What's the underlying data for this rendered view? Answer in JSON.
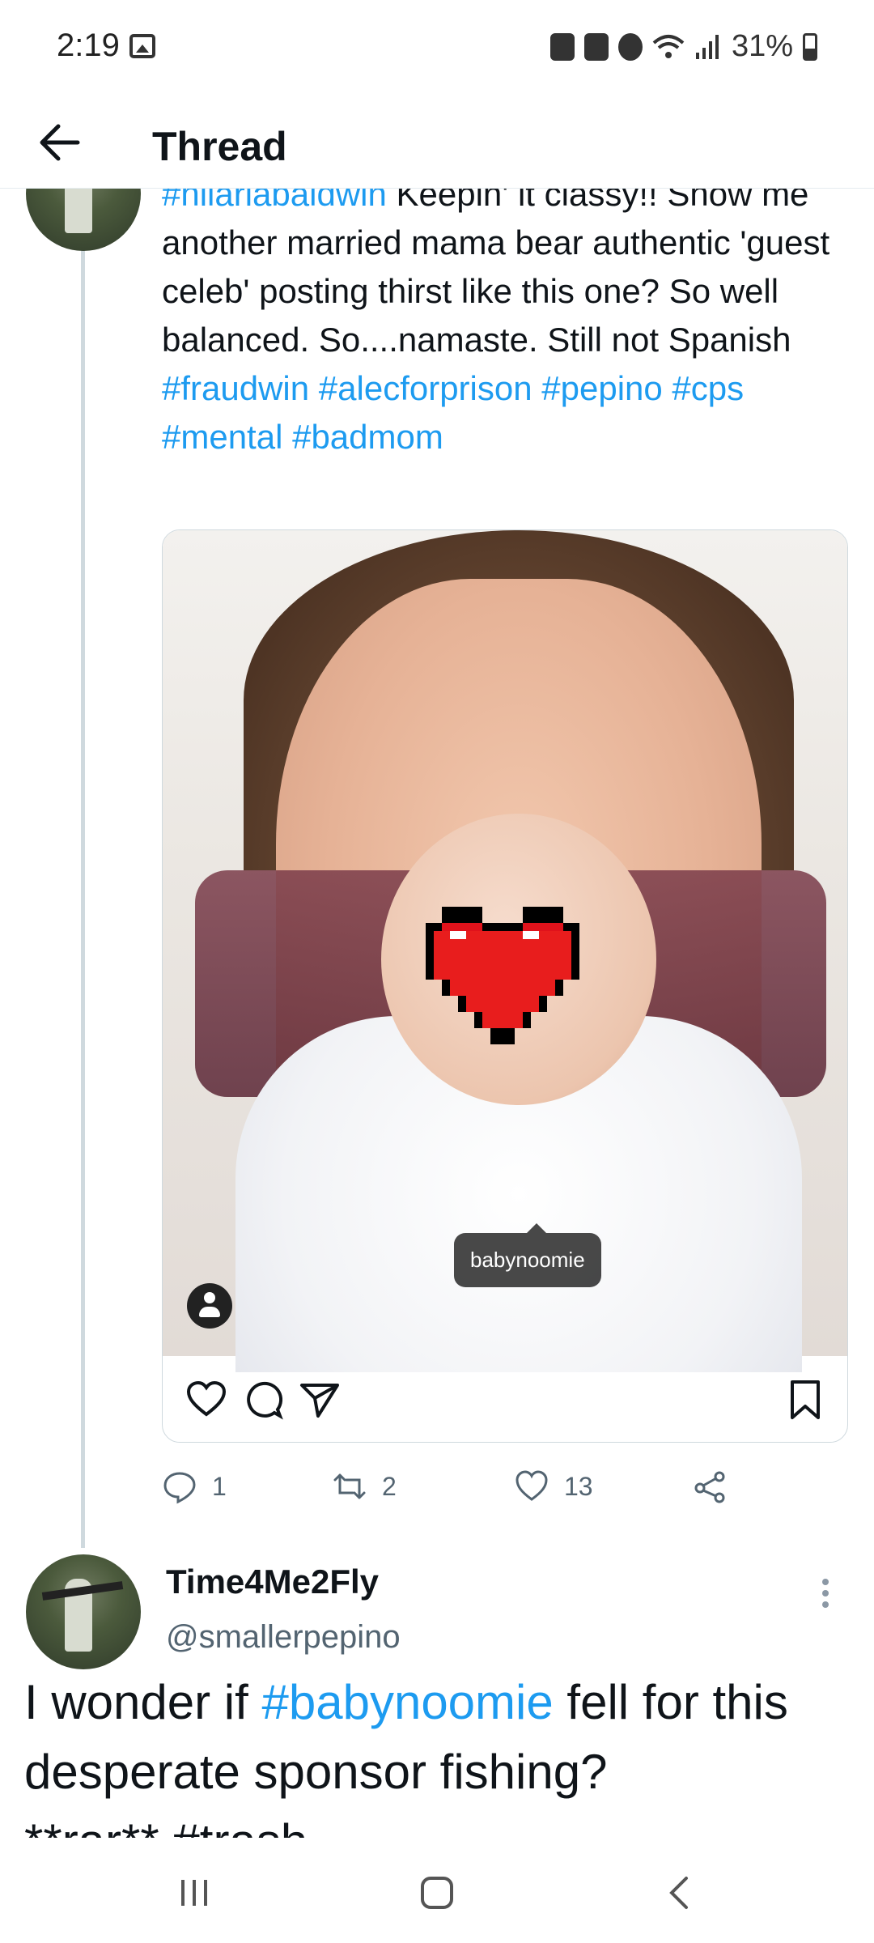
{
  "status_bar": {
    "time": "2:19",
    "battery": "31%",
    "icons": [
      "gallery-icon",
      "android-icon",
      "nfc-icon",
      "alarm-icon",
      "wifi-icon",
      "signal-icon",
      "battery-icon"
    ]
  },
  "header": {
    "title": "Thread",
    "back_icon": "arrow-left-icon"
  },
  "tweet1": {
    "hashtag_lead": "#hilariabaldwin",
    "text_main": " Keepin' it classy!! Show me another married mama bear authentic 'guest celeb' posting thirst like this one? So well balanced. So....namaste. Still not Spanish",
    "hashtags_line": [
      "#fraudwin",
      "#alecforprison",
      "#pepino",
      "#cps",
      "#mental",
      "#badmom"
    ],
    "media": {
      "tag_label": "babynoomie"
    },
    "stats": {
      "replies": "1",
      "retweets": "2",
      "likes": "13"
    }
  },
  "tweet2": {
    "name": "Time4Me2Fly",
    "handle": "@smallerpepino",
    "text_before": "I wonder if ",
    "hashtag": "#babynoomie",
    "text_after": " fell for this desperate sponsor fishing?",
    "text_cut": "**rar** #trash"
  },
  "colors": {
    "accent": "#1d9bf0",
    "text": "#0f1419",
    "muted": "#536471",
    "thread_line": "#cfd9de"
  }
}
